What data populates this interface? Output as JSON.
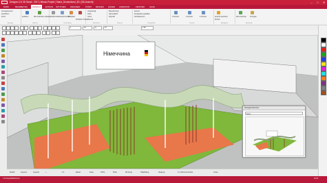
{
  "window": {
    "title": "Designer 2.6 3D Stand - 2017 | Messe-Projekt | Stand_Deutschland_3D | [3D-Ansicht]",
    "minimize": "–",
    "maximize": "□",
    "close": "✕"
  },
  "menu": {
    "items": [
      "DATEI",
      "BEARBEITEN",
      "ANSICHT",
      "EXTRAS",
      "OPTIONEN",
      "ZEICHNEN",
      "PUNKT",
      "MESSEN",
      "HÖHER",
      "ANIMATION",
      "FENSTER",
      "HILFE"
    ],
    "active_index": 2
  },
  "ribbon": {
    "groups": [
      {
        "label": "Anzeige",
        "buttons": [
          "Anzeigebereich",
          "Ausrichten",
          "Zoom"
        ]
      },
      {
        "label": "Ansicht",
        "buttons": [
          "Aufteilen",
          "Alle Ansichten aufteilen"
        ]
      },
      {
        "label": "Darstellung",
        "buttons": [
          "Drahtmodell",
          "Gesamtmodell",
          "Schattiert",
          "Schattiert-Kante"
        ]
      },
      {
        "label": "Ansichten",
        "buttons": [
          "Vorgefertigt",
          "Oben",
          "Vorne",
          "Ebenen"
        ]
      },
      {
        "label": "Kamera",
        "buttons": [
          "Mausrichtung",
          "Kamerafahrt",
          "Fixpunkt"
        ]
      },
      {
        "label": "Perspektive",
        "buttons": [
          "Zentral",
          "Perspektive gestalten",
          "Schnittebenen"
        ]
      },
      {
        "label": "Fenster",
        "buttons": [
          "3 Fenster",
          "2 Fenster",
          "4 Fenster"
        ]
      },
      {
        "label": "Navigation",
        "buttons": [
          "Ansicht speichern",
          "Zurück"
        ]
      },
      {
        "label": "Ansichten",
        "buttons": [
          "Alle Ansichten",
          "Anzeigen"
        ]
      }
    ]
  },
  "toolbar": {
    "fields": [
      "1",
      "15",
      "Q",
      "15"
    ],
    "scale": "1:50"
  },
  "scene": {
    "sign_text": "Німеччина",
    "flag_colors": [
      "#111111",
      "#d81a1a",
      "#f2c500"
    ],
    "floor_color": "#7fb83a",
    "carpet_color": "#e8774a",
    "wave_color": "#c8d9b8"
  },
  "navigator": {
    "title": "Navigationsfenster",
    "input_label": "Zoom"
  },
  "viewbar": {
    "items": [
      "Modell",
      "Layout1",
      "Layout2",
      "+",
      "1:1",
      "Raster",
      "Fang",
      "Ortho",
      "Polar",
      "3D-Fang",
      "Objektfang",
      "Neigung",
      "1:1 Wand-Grundriss",
      "Linien"
    ]
  },
  "status": {
    "left": "1 D-Fang  Blattformen",
    "mid": "",
    "right": "15:37"
  },
  "colors": {
    "brand": "#b8193a",
    "title": "#c9213c"
  }
}
